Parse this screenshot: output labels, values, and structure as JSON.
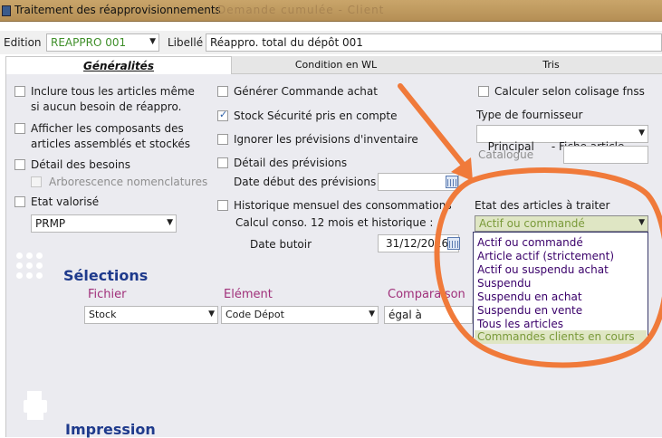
{
  "window": {
    "title": "Traitement des réapprovisionnements",
    "ghost_text": "Demande cumulée - Client"
  },
  "header": {
    "edition_label": "Edition",
    "edition_value": "REAPPRO 001",
    "libelle_label": "Libellé",
    "libelle_value": "Réappro. total du dépôt 001"
  },
  "tabs": [
    {
      "label": "Généralités",
      "active": true
    },
    {
      "label": "Condition en WL",
      "active": false
    },
    {
      "label": "Tris",
      "active": false
    }
  ],
  "left_column": {
    "inclure": {
      "label_line1": "Inclure tous les articles même",
      "label_line2": "si aucun besoin de réappro.",
      "checked": false
    },
    "afficher": {
      "label_line1": "Afficher les composants des",
      "label_line2": "articles assemblés et stockés",
      "checked": false
    },
    "detail_besoins": {
      "label": "Détail des besoins",
      "checked": false
    },
    "arborescence": {
      "label": "Arborescence nomenclatures",
      "checked": false,
      "disabled": true
    },
    "etat_valorise": {
      "label": "Etat valorisé",
      "checked": false
    },
    "valorisation_select": "PRMP"
  },
  "middle_column": {
    "generer": {
      "label": "Générer Commande achat",
      "checked": false
    },
    "stock_securite": {
      "label": "Stock Sécurité pris en compte",
      "checked": true
    },
    "ignorer": {
      "label": "Ignorer les prévisions d'inventaire",
      "checked": false
    },
    "detail_previsions": {
      "label": "Détail des prévisions",
      "checked": false
    },
    "date_debut_label": "Date début des prévisions",
    "date_debut_value": "",
    "historique": {
      "label": "Historique mensuel des consommations",
      "checked": false
    },
    "calcul_label": "Calcul conso. 12 mois et historique :",
    "date_butoir_label": "Date butoir",
    "date_butoir_value": "31/12/2016"
  },
  "right_column": {
    "colisage": {
      "label": "Calculer selon colisage fnss",
      "checked": false
    },
    "type_fournisseur_label": "Type de fournisseur",
    "type_fournisseur_value": "Principal     - Fiche article",
    "catalogue_label": "Catalogue",
    "catalogue_value": "",
    "etat_articles_label": "Etat des articles à traiter",
    "etat_articles_value": "Actif ou commandé",
    "dropdown_options": [
      "Actif ou commandé",
      "Article actif (strictement)",
      "Actif ou suspendu achat",
      "Suspendu",
      "Suspendu en achat",
      "Suspendu en vente",
      "Tous les articles",
      "Commandes clients en cours"
    ],
    "highlighted_option_index": 7
  },
  "selections": {
    "title": "Sélections",
    "fichier_header": "Fichier",
    "element_header": "Elément",
    "comparaison_header": "Comparaison",
    "fichier_value": "Stock",
    "element_value": "Code Dépot",
    "comparaison_value": "égal à"
  },
  "impression": {
    "title": "Impression"
  },
  "annotation": {
    "color": "#f07a3a"
  },
  "colors": {
    "accent_blue": "#1e3a8c",
    "header_magenta": "#a0307a",
    "edition_green": "#3f8f2a"
  }
}
